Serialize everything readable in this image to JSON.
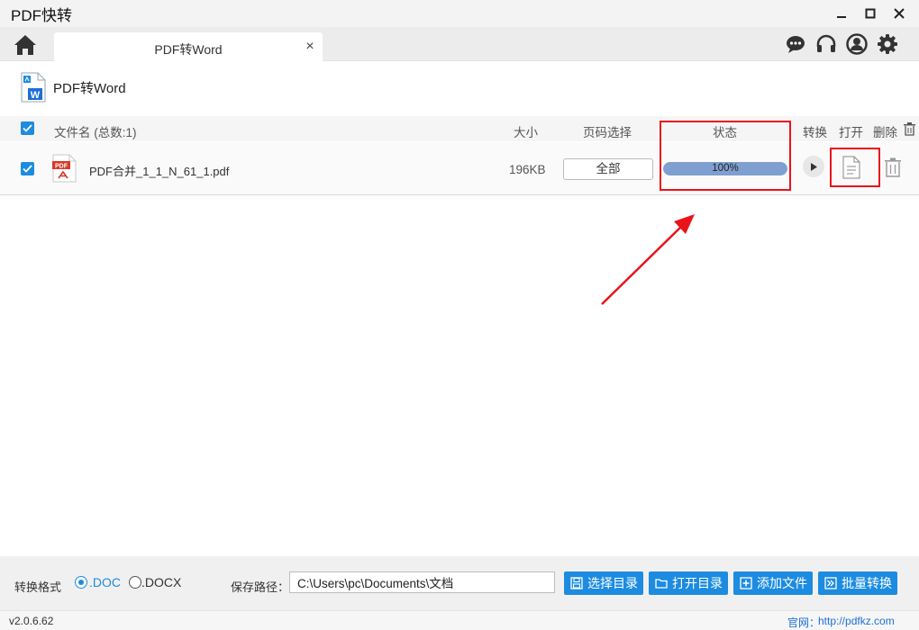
{
  "window": {
    "title": "PDF快转",
    "minimize_icon": "minimize-icon",
    "maximize_icon": "maximize-icon",
    "close_icon": "close-icon"
  },
  "tabs": [
    {
      "label": "PDF转Word",
      "close": "×"
    }
  ],
  "header_icons": [
    "chat-icon",
    "headset-icon",
    "user-icon",
    "gear-icon"
  ],
  "section": {
    "title": "PDF转Word",
    "icon": "word-document-icon"
  },
  "table": {
    "headers": {
      "filename": "文件名 (总数:1)",
      "size": "大小",
      "page_select": "页码选择",
      "status": "状态",
      "convert": "转换",
      "open": "打开",
      "delete": "删除"
    },
    "rows": [
      {
        "checked": true,
        "file_icon": "pdf-file-icon",
        "filename": "PDF合并_1_1_N_61_1.pdf",
        "size": "196KB",
        "page_select": "全部",
        "progress": 1.0,
        "progress_text": "100%"
      }
    ]
  },
  "footer": {
    "format_label": "转换格式",
    "formats": [
      {
        "label": ".DOC",
        "selected": true
      },
      {
        "label": ".DOCX",
        "selected": false
      }
    ],
    "path_label": "保存路径：",
    "path_value": "C:\\Users\\pc\\Documents\\文档",
    "buttons": {
      "choose_dir": "选择目录",
      "open_dir": "打开目录",
      "add_file": "添加文件",
      "batch_convert": "批量转换"
    }
  },
  "statusbar": {
    "version": "v2.0.6.62",
    "site_label": "官网：",
    "site_url": "http://pdfkz.com"
  },
  "colors": {
    "accent": "#1d8ce0",
    "progress": "#7f9fd0",
    "annotation": "#e8141a"
  }
}
